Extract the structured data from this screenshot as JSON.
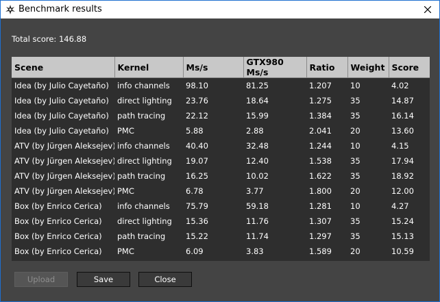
{
  "window": {
    "title": "Benchmark results"
  },
  "total": {
    "text": "Total score: 146.88"
  },
  "table": {
    "columns": [
      "Scene",
      "Kernel",
      "Ms/s",
      "GTX980 Ms/s",
      "Ratio",
      "Weight",
      "Score"
    ],
    "rows": [
      [
        "Idea (by Julio Cayetaño)",
        "info channels",
        "98.10",
        "81.25",
        "1.207",
        "10",
        "4.02"
      ],
      [
        "Idea (by Julio Cayetaño)",
        "direct lighting",
        "23.76",
        "18.64",
        "1.275",
        "35",
        "14.87"
      ],
      [
        "Idea (by Julio Cayetaño)",
        "path tracing",
        "22.12",
        "15.99",
        "1.384",
        "35",
        "16.14"
      ],
      [
        "Idea (by Julio Cayetaño)",
        "PMC",
        "5.88",
        "2.88",
        "2.041",
        "20",
        "13.60"
      ],
      [
        "ATV (by Jürgen Aleksejev)",
        "info channels",
        "40.40",
        "32.48",
        "1.244",
        "10",
        "4.15"
      ],
      [
        "ATV (by Jürgen Aleksejev)",
        "direct lighting",
        "19.07",
        "12.40",
        "1.538",
        "35",
        "17.94"
      ],
      [
        "ATV (by Jürgen Aleksejev)",
        "path tracing",
        "16.25",
        "10.02",
        "1.622",
        "35",
        "18.92"
      ],
      [
        "ATV (by Jürgen Aleksejev)",
        "PMC",
        "6.78",
        "3.77",
        "1.800",
        "20",
        "12.00"
      ],
      [
        "Box (by Enrico Cerica)",
        "info channels",
        "75.79",
        "59.18",
        "1.281",
        "10",
        "4.27"
      ],
      [
        "Box (by Enrico Cerica)",
        "direct lighting",
        "15.36",
        "11.76",
        "1.307",
        "35",
        "15.24"
      ],
      [
        "Box (by Enrico Cerica)",
        "path tracing",
        "15.22",
        "11.74",
        "1.297",
        "35",
        "15.13"
      ],
      [
        "Box (by Enrico Cerica)",
        "PMC",
        "6.09",
        "3.83",
        "1.589",
        "20",
        "10.59"
      ]
    ]
  },
  "buttons": {
    "upload": "Upload",
    "save": "Save",
    "close": "Close"
  },
  "icons": {
    "app": "octane-logo-icon",
    "close": "close-icon"
  },
  "colors": {
    "window_bg": "#444444",
    "table_bg": "#2e2e2e",
    "header_bg": "#c8c8c8",
    "border": "#1e6fd0"
  }
}
